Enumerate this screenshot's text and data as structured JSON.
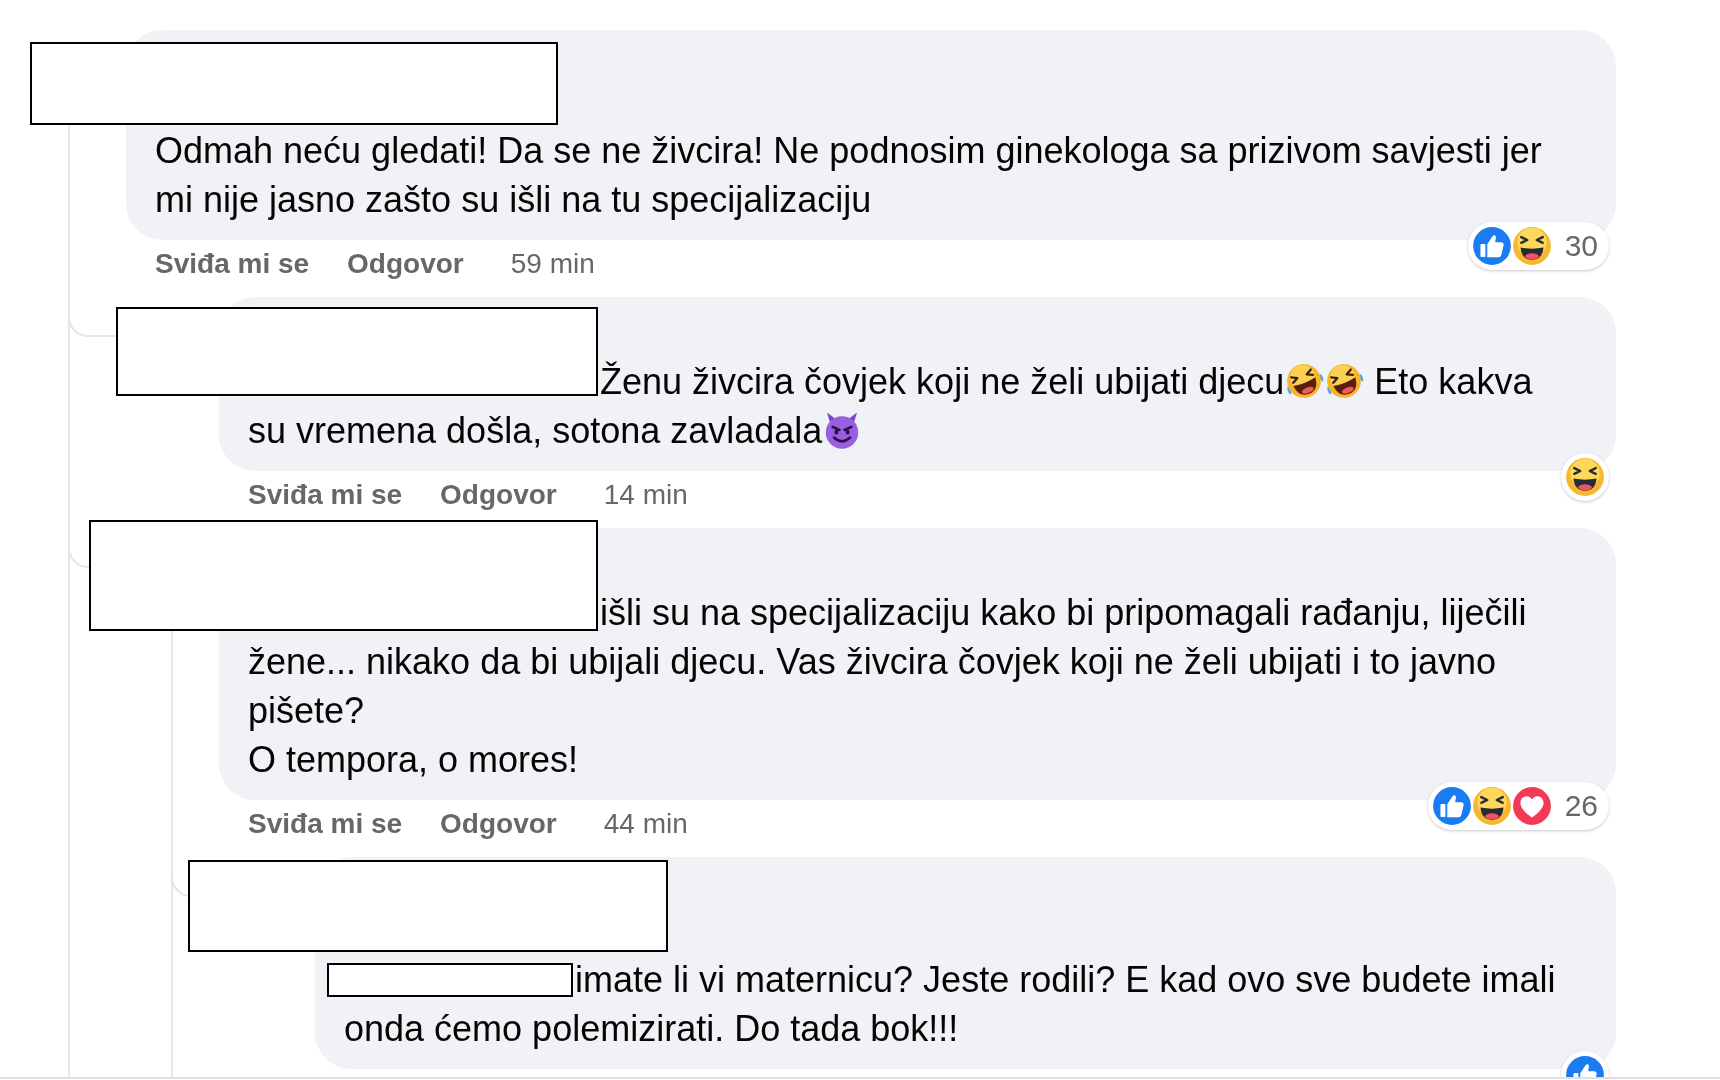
{
  "comments": [
    {
      "author_redacted": true,
      "body": [
        [
          {
            "kind": "text",
            "text": "Odmah neću gledati! Da se ne živcira! Ne podnosim ginekologa sa prizivom savjesti jer mi nije jasno zašto su išli na tu specijalizaciju"
          }
        ]
      ],
      "like_label": "Sviđa mi se",
      "reply_label": "Odgovor",
      "time": "59 min",
      "reactions": {
        "icons": [
          {
            "kind": "like"
          },
          {
            "kind": "haha"
          }
        ],
        "count": "30"
      },
      "replies": [
        {
          "author_redacted": true,
          "body": [
            [
              {
                "kind": "mention_covered"
              },
              {
                "kind": "text",
                "text": "Ženu živcira čovjek koji ne želi ubijati djecu"
              },
              {
                "kind": "laugh_cry"
              },
              {
                "kind": "laugh_cry"
              },
              {
                "kind": "text",
                "text": " Eto kakva"
              }
            ],
            [
              {
                "kind": "text",
                "text": "su vremena došla, sotona zavladala"
              },
              {
                "kind": "devil"
              }
            ]
          ],
          "like_label": "Sviđa mi se",
          "reply_label": "Odgovor",
          "time": "14 min",
          "reactions": {
            "icons": [
              {
                "kind": "haha"
              }
            ]
          }
        },
        {
          "author_redacted": true,
          "body": [
            [
              {
                "kind": "mention_covered"
              },
              {
                "kind": "text",
                "text": "išli su na specijalizaciju kako bi pripomagali rađanju, liječili žene... nikako da bi ubijali djecu. Vas živcira čovjek koji ne želi ubijati i to javno pišete?\nO tempora, o mores!"
              }
            ]
          ],
          "like_label": "Sviđa mi se",
          "reply_label": "Odgovor",
          "time": "44 min",
          "reactions": {
            "icons": [
              {
                "kind": "like"
              },
              {
                "kind": "haha"
              },
              {
                "kind": "love"
              }
            ],
            "count": "26"
          },
          "replies": [
            {
              "author_redacted": true,
              "body": [
                [
                  {
                    "kind": "mention_boxed"
                  },
                  {
                    "kind": "text",
                    "text": "imate li vi maternicu? Jeste rodili? E kad ovo sve budete imali"
                  }
                ],
                [
                  {
                    "kind": "text",
                    "text": "onda ćemo polemizirati. Do tada bok!!!"
                  }
                ]
              ],
              "reactions": {
                "icons": [
                  {
                    "kind": "like"
                  }
                ]
              }
            }
          ]
        }
      ]
    }
  ]
}
